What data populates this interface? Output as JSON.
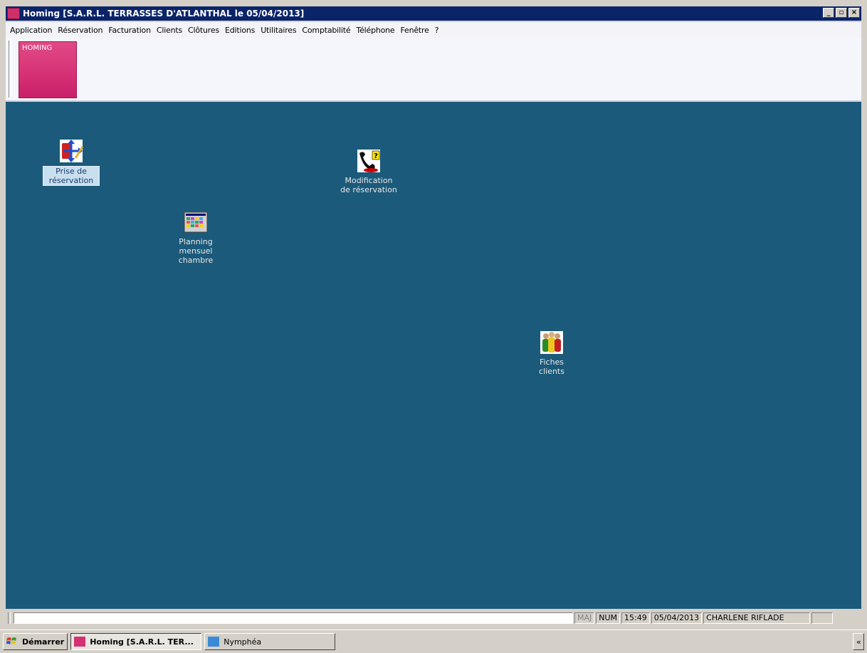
{
  "window": {
    "title": "Homing [S.A.R.L. TERRASSES D'ATLANTHAL le 05/04/2013]",
    "controls": {
      "minimize": "_",
      "restore": "▫",
      "close": "×"
    }
  },
  "menu": [
    "Application",
    "Réservation",
    "Facturation",
    "Clients",
    "Clôtures",
    "Editions",
    "Utilitaires",
    "Comptabilité",
    "Téléphone",
    "Fenêtre",
    "?"
  ],
  "toolbar": {
    "tile_label": "HOMING",
    "tile_color": "#d63074"
  },
  "workspace": {
    "background": "#1b5a7a",
    "icons": [
      {
        "name": "reservation-icon",
        "label": "Prise de réservation",
        "selected": true
      },
      {
        "name": "modification-icon",
        "label": "Modification de réservation"
      },
      {
        "name": "planning-icon",
        "label": "Planning mensuel chambre"
      },
      {
        "name": "clients-icon",
        "label": "Fiches clients"
      }
    ]
  },
  "statusbar": {
    "field": "",
    "maj": "MAJ",
    "num": "NUM",
    "time": "15:49",
    "date": "05/04/2013",
    "user": "CHARLENE RIFLADE"
  },
  "taskbar": {
    "start": "Démarrer",
    "tasks": [
      "Homing [S.A.R.L. TER...",
      "Nymphéa"
    ],
    "tray_button": "«"
  }
}
